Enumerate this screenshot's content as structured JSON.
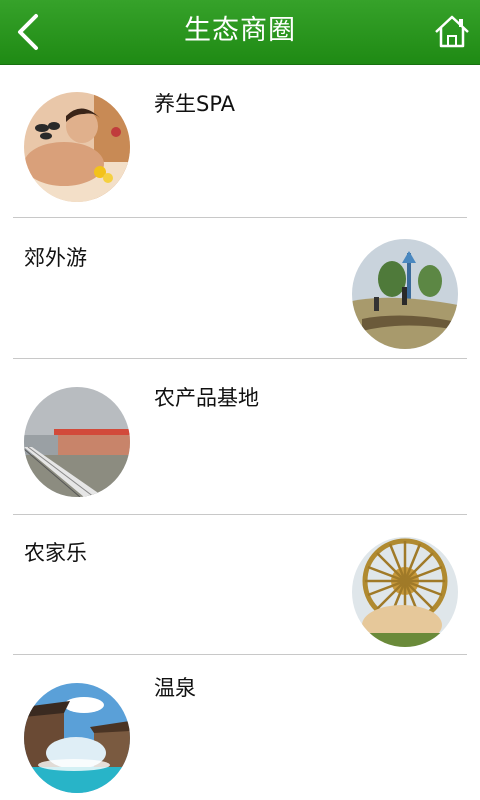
{
  "header": {
    "title": "生态商圈",
    "back_icon": "chevron-left-icon",
    "home_icon": "home-icon"
  },
  "items": [
    {
      "label": "养生SPA",
      "thumb": "spa-photo"
    },
    {
      "label": "郊外游",
      "thumb": "outing-photo"
    },
    {
      "label": "农产品基地",
      "thumb": "farm-base-photo"
    },
    {
      "label": "农家乐",
      "thumb": "farmhouse-waterwheel-photo"
    },
    {
      "label": "温泉",
      "thumb": "hot-spring-photo"
    }
  ],
  "colors": {
    "header_green": "#2a9a1e",
    "divider": "#c8c8c8"
  }
}
